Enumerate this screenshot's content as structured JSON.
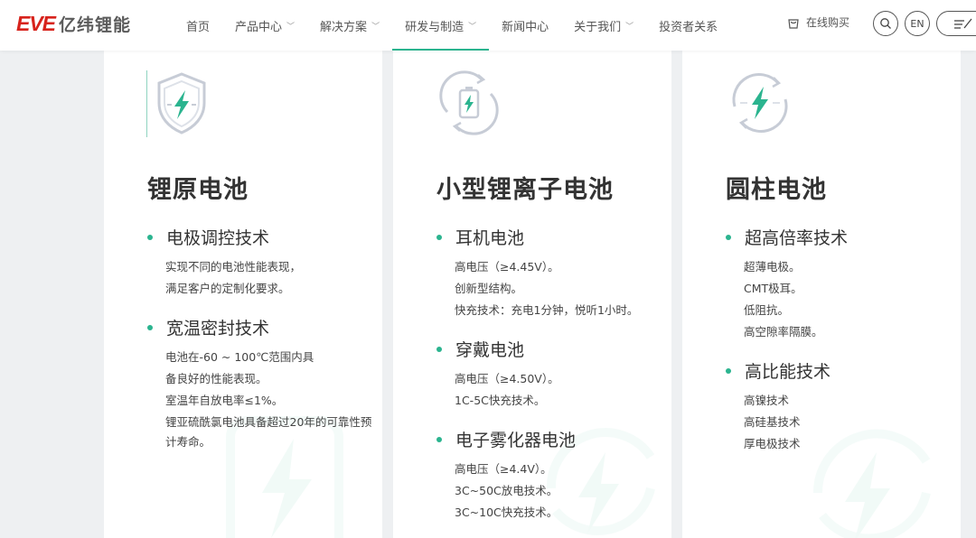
{
  "header": {
    "logo_mark": "EVE",
    "logo_text": "亿纬锂能",
    "nav": [
      {
        "label": "首页",
        "dropdown": false
      },
      {
        "label": "产品中心",
        "dropdown": true
      },
      {
        "label": "解决方案",
        "dropdown": true
      },
      {
        "label": "研发与制造",
        "dropdown": true,
        "active": true
      },
      {
        "label": "新闻中心",
        "dropdown": false
      },
      {
        "label": "关于我们",
        "dropdown": true
      },
      {
        "label": "投资者关系",
        "dropdown": false
      }
    ],
    "buy_label": "在线购买",
    "lang_label": "EN",
    "accent_color": "#2bb48f"
  },
  "cards": [
    {
      "title": "锂原电池",
      "icon": "shield-bolt-icon",
      "features": [
        {
          "name": "电极调控技术",
          "lines": [
            "实现不同的电池性能表现，",
            "满足客户的定制化要求。"
          ]
        },
        {
          "name": "宽温密封技术",
          "lines": [
            "电池在-60 ~ 100℃范围内具",
            "备良好的性能表现。",
            "室温年自放电率≤1%。",
            "锂亚硫酰氯电池具备超过20年的可靠性预计寿命。"
          ]
        }
      ]
    },
    {
      "title": "小型锂离子电池",
      "icon": "battery-cycle-icon",
      "features": [
        {
          "name": "耳机电池",
          "lines": [
            "高电压（≥4.45V）。",
            "创新型结构。",
            "快充技术：充电1分钟，悦听1小时。"
          ]
        },
        {
          "name": "穿戴电池",
          "lines": [
            "高电压（≥4.50V）。",
            "1C-5C快充技术。"
          ]
        },
        {
          "name": "电子雾化器电池",
          "lines": [
            "高电压（≥4.4V）。",
            "3C~50C放电技术。",
            "3C~10C快充技术。"
          ]
        }
      ]
    },
    {
      "title": "圆柱电池",
      "icon": "cycle-bolt-icon",
      "features": [
        {
          "name": "超高倍率技术",
          "lines": [
            "超薄电极。",
            "CMT极耳。",
            "低阻抗。",
            "高空隙率隔膜。"
          ]
        },
        {
          "name": "高比能技术",
          "lines": [
            "高镍技术",
            "高硅基技术",
            "厚电极技术"
          ]
        }
      ]
    }
  ]
}
